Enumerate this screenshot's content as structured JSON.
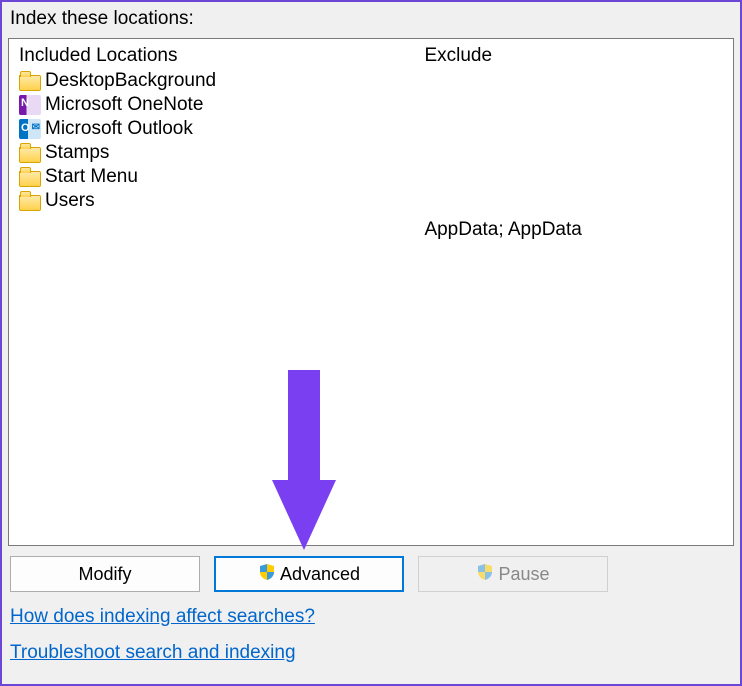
{
  "heading": "Index these locations:",
  "columns": {
    "included_header": "Included Locations",
    "exclude_header": "Exclude"
  },
  "included": [
    {
      "icon": "folder",
      "label": "DesktopBackground",
      "exclude": ""
    },
    {
      "icon": "onenote",
      "label": "Microsoft OneNote",
      "exclude": ""
    },
    {
      "icon": "outlook",
      "label": "Microsoft Outlook",
      "exclude": ""
    },
    {
      "icon": "folder",
      "label": "Stamps",
      "exclude": ""
    },
    {
      "icon": "folder",
      "label": "Start Menu",
      "exclude": ""
    },
    {
      "icon": "folder",
      "label": "Users",
      "exclude": "AppData; AppData"
    }
  ],
  "buttons": {
    "modify": "Modify",
    "advanced": "Advanced",
    "pause": "Pause"
  },
  "links": {
    "how": "How does indexing affect searches?",
    "troubleshoot": "Troubleshoot search and indexing"
  }
}
